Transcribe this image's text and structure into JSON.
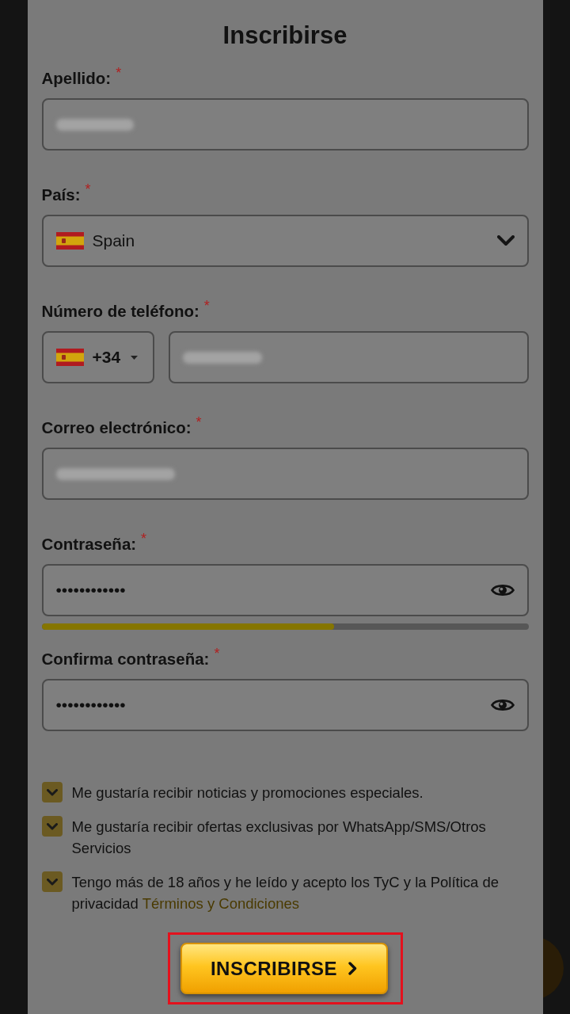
{
  "dialog": {
    "title": "Inscribirse"
  },
  "fields": [
    {
      "kind": "text",
      "label": "Apellido:",
      "asterisk": "*",
      "blurred": true
    },
    {
      "kind": "select",
      "label": "País:",
      "asterisk": "*",
      "value": "Spain"
    },
    {
      "kind": "phone",
      "label": "Número de teléfono:",
      "asterisk": "*",
      "code": "+34",
      "blurred": true
    },
    {
      "kind": "email",
      "label": "Correo electrónico:",
      "asterisk": "*",
      "blurred": true
    },
    {
      "kind": "password",
      "label": "Contraseña:",
      "asterisk": "*",
      "value": "••••••••••••",
      "strength": {
        "level": 0.6
      }
    },
    {
      "kind": "password",
      "label": "Confirma contraseña:",
      "asterisk": "*",
      "value": "••••••••••••"
    }
  ],
  "consents": [
    {
      "checked": true,
      "text": "Me gustaría recibir noticias y promociones especiales."
    },
    {
      "checked": true,
      "text": "Me gustaría recibir ofertas exclusivas por WhatsApp/SMS/Otros Servicios"
    },
    {
      "checked": true,
      "text": "Tengo más de 18 años y he leído y acepto los TyC y la Política de privacidad",
      "link": "Términos y Condiciones"
    }
  ],
  "submit": {
    "label": "INSCRIBIRSE",
    "highlighted": true
  }
}
